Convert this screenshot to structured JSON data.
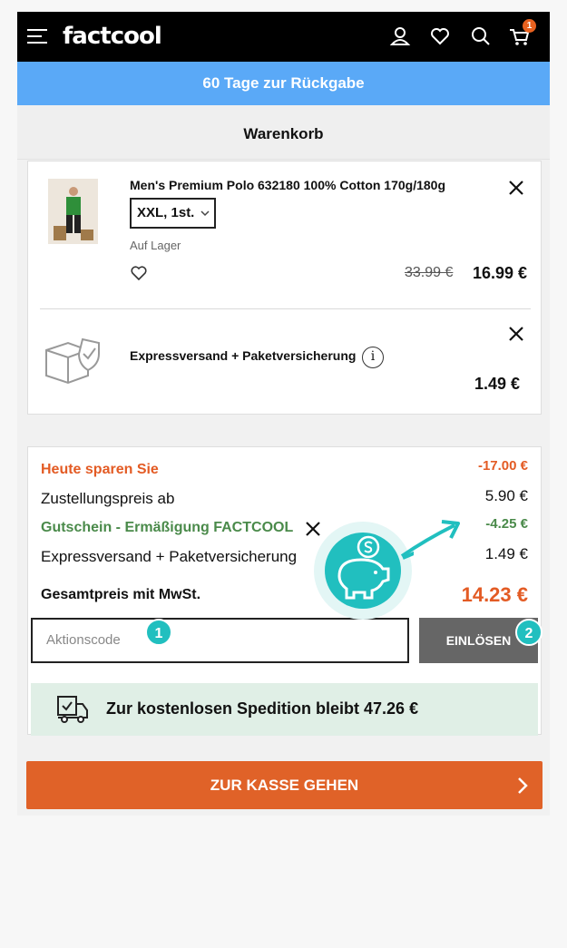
{
  "header": {
    "logo": "factcool",
    "cart_count": "1",
    "icons": [
      "menu-icon",
      "user-icon",
      "heart-icon",
      "search-icon",
      "cart-icon"
    ]
  },
  "banner": {
    "text": "60 Tage zur Rückgabe"
  },
  "page": {
    "title": "Warenkorb"
  },
  "cart": {
    "item": {
      "name": "Men's Premium Polo 632180 100% Cotton 170g/180g",
      "size": "XXL, 1st.",
      "stock": "Auf Lager",
      "old_price": "33.99 €",
      "price": "16.99 €"
    },
    "extra": {
      "name": "Expressversand + Paketversicherung",
      "price": "1.49 €"
    }
  },
  "summary": {
    "rows": [
      {
        "label": "Heute sparen Sie",
        "value": "-17.00 €"
      },
      {
        "label": "Zustellungspreis ab",
        "value": "5.90 €"
      },
      {
        "label": "Gutschein - Ermäßigung FACTCOOL",
        "value": "-4.25 €"
      },
      {
        "label": "Expressversand + Paketversicherung",
        "value": "1.49 €"
      },
      {
        "label": "Gesamtpreis mit MwSt.",
        "value": "14.23 €"
      }
    ],
    "promo_placeholder": "Aktionscode",
    "redeem_label": "EINLÖSEN",
    "step1": "1",
    "step2": "2",
    "shipping_text": "Zur kostenlosen Spedition bleibt 47.26 €"
  },
  "checkout": {
    "label": "ZUR KASSE GEHEN"
  },
  "colors": {
    "accent": "#e06228",
    "banner": "#5aa9f7",
    "teal": "#21bfbf",
    "green": "#4a8a4a"
  }
}
